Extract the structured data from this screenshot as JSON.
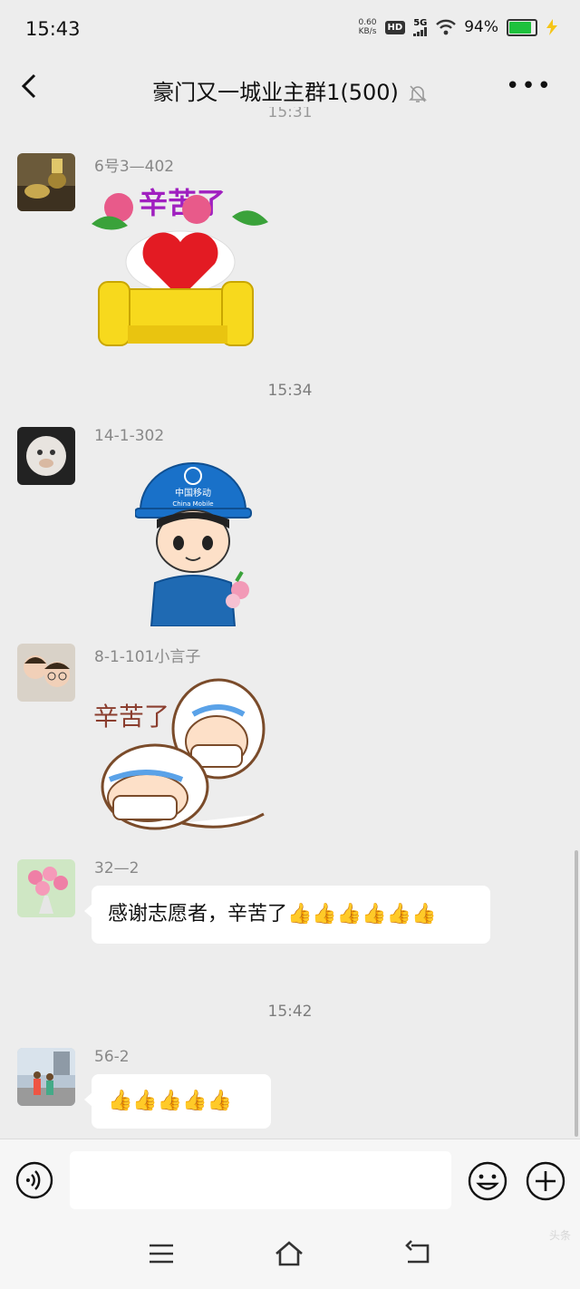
{
  "status_bar": {
    "time": "15:43",
    "net_speed_value": "0.60",
    "net_speed_unit": "KB/s",
    "hd": "HD",
    "network": "5G",
    "battery": "94%",
    "battery_level": 0.94
  },
  "header": {
    "title": "豪门又一城业主群1(500)",
    "partial_timestamp": "15:31"
  },
  "timestamps": [
    "15:34",
    "15:42"
  ],
  "messages": [
    {
      "sender": "6号3—402",
      "sticker_text": "辛苦了"
    },
    {
      "sender": "14-1-302",
      "sticker_text": "中国移动",
      "sticker_subtext": "China Mobile"
    },
    {
      "sender": "8-1-101小言子",
      "sticker_text": "辛苦了"
    },
    {
      "sender": "32—2",
      "text": "感谢志愿者，辛苦了",
      "thumbs": [
        "👍",
        "👍",
        "👍",
        "👍",
        "👍",
        "👍"
      ]
    },
    {
      "sender": "56-2",
      "thumbs": [
        "👍",
        "👍",
        "👍",
        "👍",
        "👍"
      ]
    }
  ],
  "watermark": "头条"
}
